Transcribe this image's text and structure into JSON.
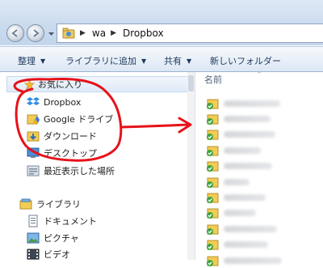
{
  "window": {
    "breadcrumb": [
      "wa",
      "Dropbox"
    ]
  },
  "toolbar": {
    "organize": "整理",
    "add_to_library": "ライブラリに追加",
    "share": "共有",
    "new_folder": "新しいフォルダー"
  },
  "nav": {
    "favorites": {
      "label": "お気に入り",
      "items": [
        {
          "label": "Dropbox",
          "icon": "dropbox-icon"
        },
        {
          "label": "Google ドライブ",
          "icon": "google-drive-folder-icon"
        },
        {
          "label": "ダウンロード",
          "icon": "download-folder-icon"
        },
        {
          "label": "デスクトップ",
          "icon": "desktop-folder-icon"
        },
        {
          "label": "最近表示した場所",
          "icon": "recent-places-icon"
        }
      ]
    },
    "libraries": {
      "label": "ライブラリ",
      "items": [
        {
          "label": "ドキュメント",
          "icon": "documents-icon"
        },
        {
          "label": "ピクチャ",
          "icon": "pictures-icon"
        },
        {
          "label": "ビデオ",
          "icon": "video-icon"
        }
      ]
    }
  },
  "content": {
    "column_name": "名前",
    "files_blurred_count": 11
  },
  "colors": {
    "annotation_red": "#e6121a",
    "sync_green": "#3aa53a",
    "folder_yellow": "#f2cc55"
  }
}
